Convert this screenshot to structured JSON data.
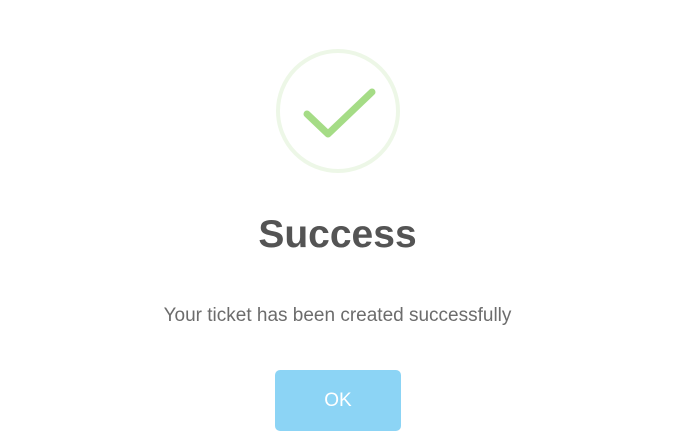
{
  "dialog": {
    "icon": "success-checkmark-icon",
    "title": "Success",
    "message": "Your ticket has been created successfully",
    "ok_label": "OK"
  },
  "colors": {
    "checkmark": "#a5dc86",
    "ring": "#edf7e7",
    "title_text": "#545454",
    "message_text": "#6c6c6c",
    "button_bg": "#8cd4f5",
    "button_text": "#ffffff"
  }
}
